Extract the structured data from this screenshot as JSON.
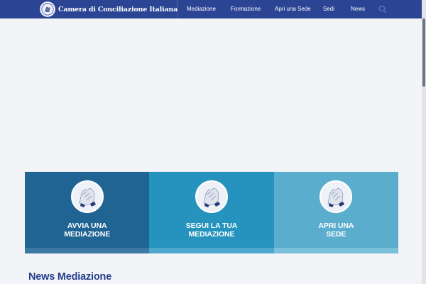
{
  "header": {
    "brand": "Camera di Conciliazione Italiana",
    "nav": [
      {
        "label": "Mediazione"
      },
      {
        "label": "Formazione"
      },
      {
        "label": "Apri una Sede"
      },
      {
        "label": "Sedi"
      },
      {
        "label": "News"
      }
    ],
    "search_icon": "search-icon",
    "logo_icon": "hands-logo-icon"
  },
  "tiles": [
    {
      "line1": "AVVIA UNA",
      "line2": "MEDIAZIONE",
      "color": "#1f6492",
      "stripe": "#3c7aa5",
      "icon": "handshake-icon"
    },
    {
      "line1": "SEGUI LA TUA",
      "line2": "MEDIAZIONE",
      "color": "#2593be",
      "stripe": "#4ea7cc",
      "icon": "handshake-icon"
    },
    {
      "line1": "APRI UNA",
      "line2": "SEDE",
      "color": "#5badce",
      "stripe": "#7ac0db",
      "icon": "handshake-icon"
    }
  ],
  "news": {
    "heading": "News Mediazione"
  },
  "colors": {
    "navbar": "#2b4494",
    "page_bg": "#f2f4f7",
    "heading": "#253f8c"
  }
}
